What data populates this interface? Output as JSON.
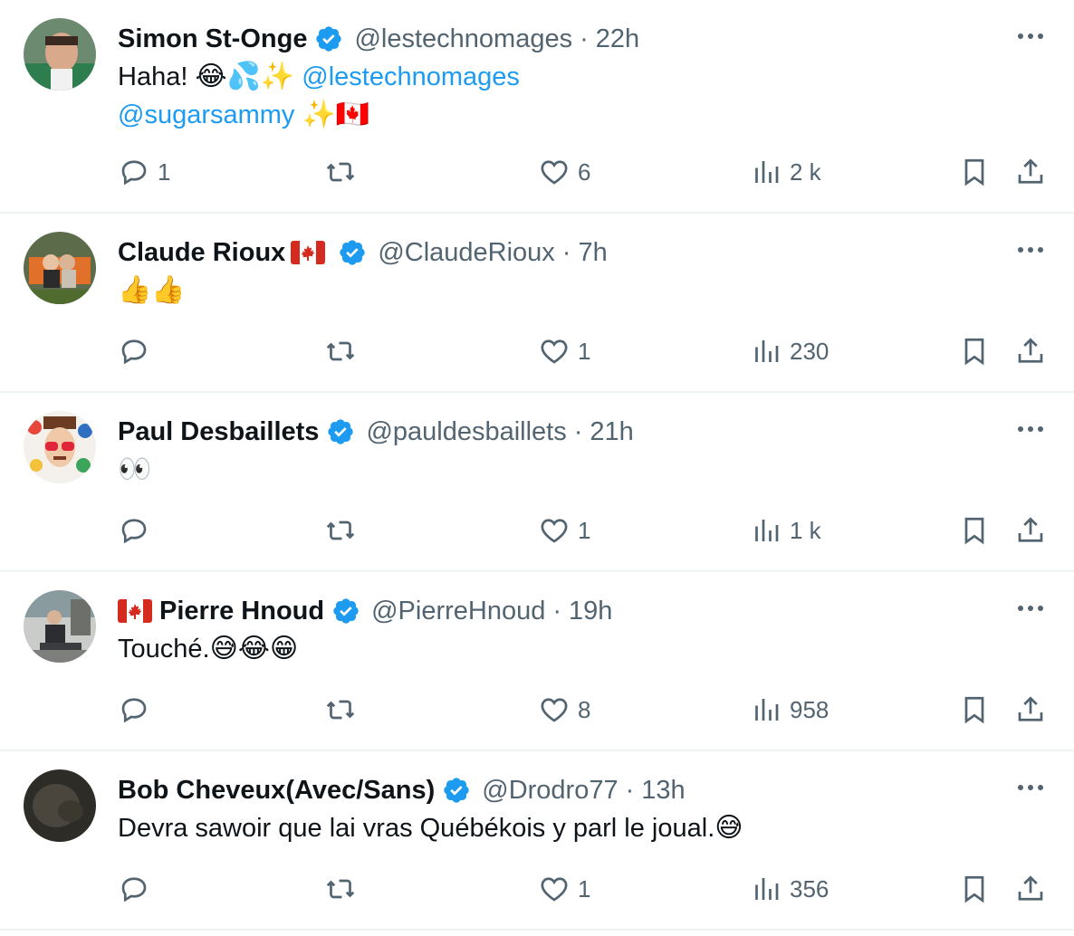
{
  "colors": {
    "accent": "#1d9bf0",
    "muted": "#536471",
    "text": "#0f1419",
    "divider": "#eff3f4"
  },
  "tweets": [
    {
      "name": "Simon St-Onge",
      "flag_before": "",
      "flag_after": "",
      "verified": true,
      "handle": "@lestechnomages",
      "dot": "·",
      "time": "22h",
      "line1_text": "Haha! ",
      "line1_emoji": "😂💦✨",
      "line1_mention": "@lestechnomages",
      "line2_mention": "@sugarsammy",
      "line2_emoji": "✨🇨🇦",
      "replies": "1",
      "retweets": "",
      "likes": "6",
      "views": "2 k"
    },
    {
      "name": "Claude Rioux",
      "flag_after": "🇨🇦",
      "verified": true,
      "handle": "@ClaudeRioux",
      "dot": "·",
      "time": "7h",
      "text": "",
      "emoji": "👍👍",
      "replies": "",
      "retweets": "",
      "likes": "1",
      "views": "230"
    },
    {
      "name": "Paul Desbaillets",
      "verified": true,
      "handle": "@pauldesbaillets",
      "dot": "·",
      "time": "21h",
      "text": "",
      "emoji": "👀",
      "replies": "",
      "retweets": "",
      "likes": "1",
      "views": "1 k"
    },
    {
      "name": "Pierre Hnoud",
      "flag_before": "🇨🇦",
      "verified": true,
      "handle": "@PierreHnoud",
      "dot": "·",
      "time": "19h",
      "text": "Touché.",
      "emoji": "😅😂😁",
      "replies": "",
      "retweets": "",
      "likes": "8",
      "views": "958"
    },
    {
      "name": "Bob Cheveux(Avec/Sans)",
      "verified": true,
      "handle": "@Drodro77",
      "dot": "·",
      "time": "13h",
      "text": "Devra sawoir que lai vras Québékois y parl le joual.",
      "emoji": "😅",
      "replies": "",
      "retweets": "",
      "likes": "1",
      "views": "356"
    }
  ]
}
